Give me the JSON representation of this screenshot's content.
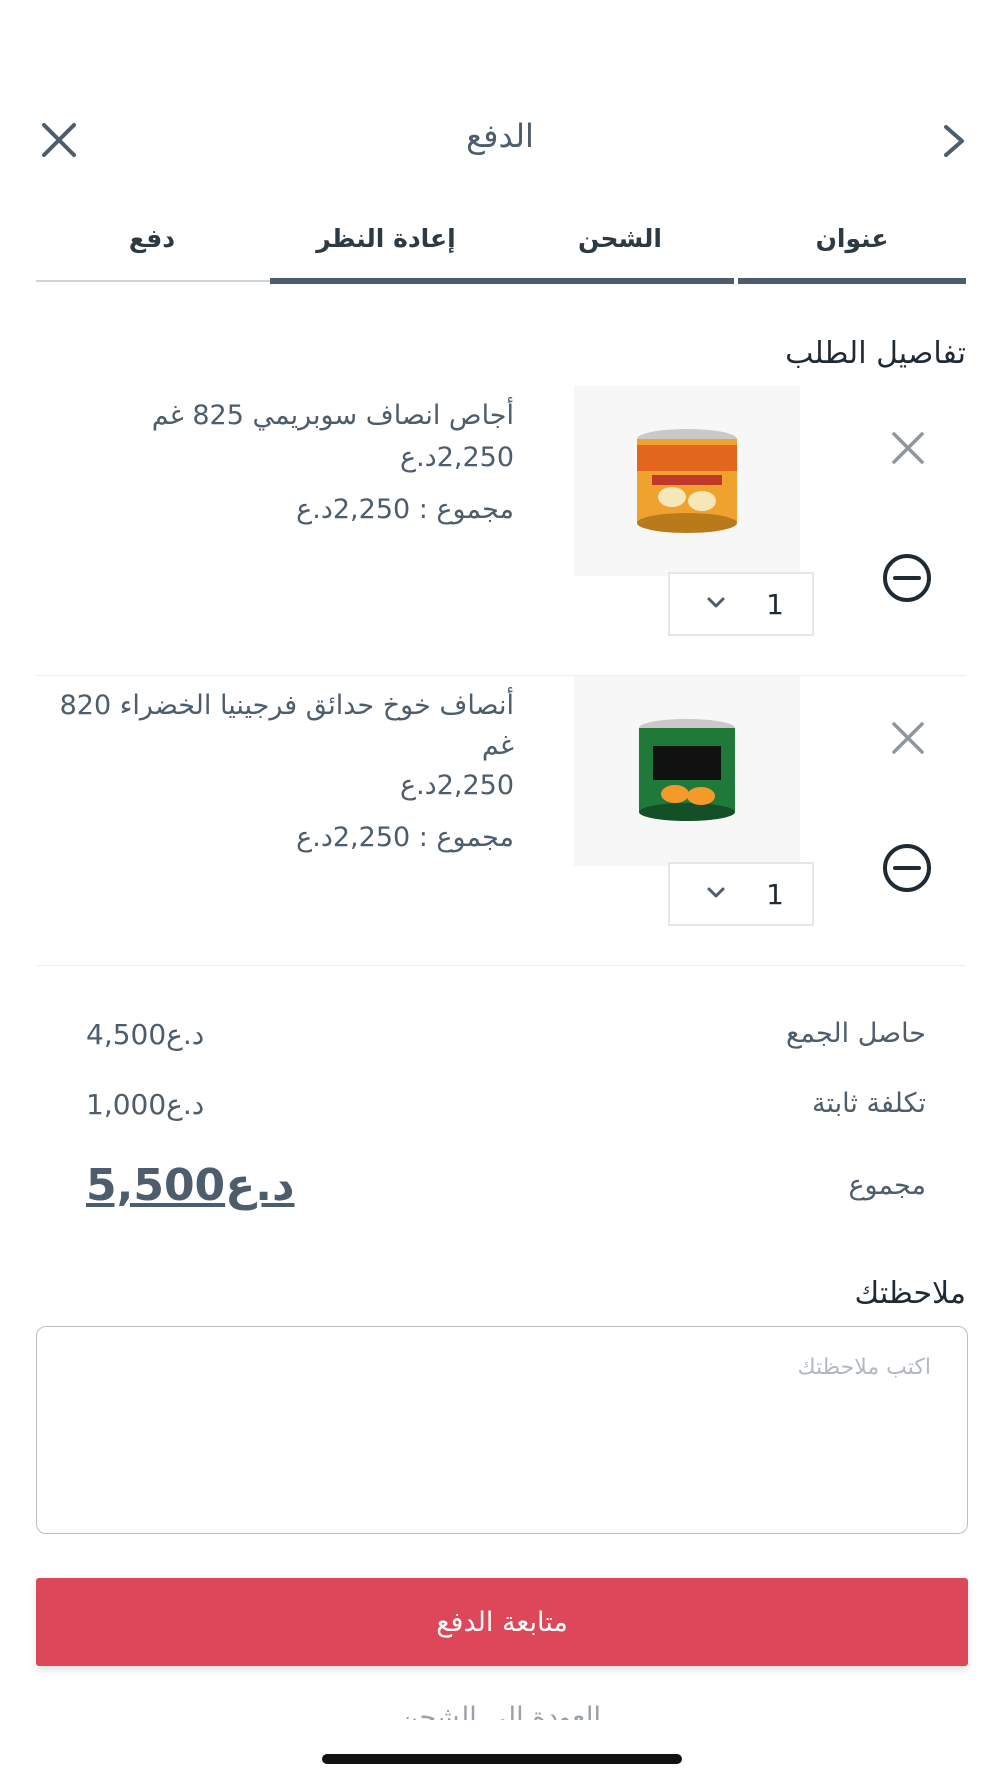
{
  "header": {
    "title": "الدفع"
  },
  "steps": [
    {
      "label": "عنوان"
    },
    {
      "label": "الشحن"
    },
    {
      "label": "إعادة النظر"
    },
    {
      "label": "دفع"
    }
  ],
  "order": {
    "section_title": "تفاصيل الطلب",
    "items": [
      {
        "name": "أجاص انصاف سوبريمي 825 غم",
        "unit_price": "2,250د.ع",
        "line_total": "مجموع : 2,250د.ع",
        "quantity": "1",
        "image": "canned-pears-can",
        "image_color": "#f0a22e"
      },
      {
        "name": "أنصاف خوخ حدائق فرجينيا الخضراء 820 غم",
        "unit_price": "2,250د.ع",
        "line_total": "مجموع : 2,250د.ع",
        "quantity": "1",
        "image": "canned-peaches-can",
        "image_color": "#1f7a3a"
      }
    ]
  },
  "summary": {
    "subtotal_label": "حاصل الجمع",
    "subtotal_value": "4,500د.ع",
    "fixed_cost_label": "تكلفة ثابتة",
    "fixed_cost_value": "1,000د.ع",
    "total_label": "مجموع",
    "total_value": "5,500د.ع"
  },
  "notes": {
    "title": "ملاحظتك",
    "placeholder": "اكتب ملاحظتك"
  },
  "actions": {
    "continue_label": "متابعة الدفع",
    "back_label": "العودة إلى الشحن"
  },
  "colors": {
    "primary_text": "#4e5d6b",
    "accent_button": "#dc4859",
    "active_step": "#4e5d6b"
  }
}
